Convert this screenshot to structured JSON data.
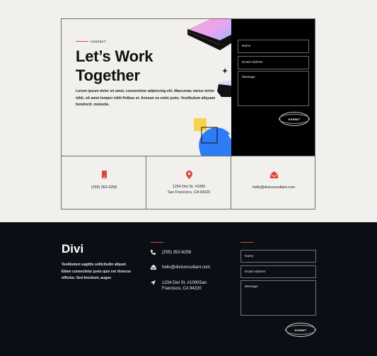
{
  "contact": {
    "eyebrow": "CONTACT",
    "title_line1": "Let’s Work",
    "title_line2": "Together",
    "lede": "Lorem ipsum dolor sit amet, consectetur adipiscing elit. Maecenas varius tortor nibh, sit amet tempor nibh finibus et. Aenean eu enim justo. Vestibulum aliquam hendrerit. molestie."
  },
  "form": {
    "name_placeholder": "Name",
    "email_placeholder": "Email Address",
    "message_placeholder": "Message",
    "submit_label": "SUBMIT"
  },
  "info": {
    "phone": "(255) 352-6258",
    "address_line1": "1234 Divi St. #1000",
    "address_line2": "San Francisco, CA 94220",
    "email": "hello@diviconsultant.com"
  },
  "footer": {
    "brand": "Divi",
    "about": "Vestibulum sagittis sollicitudin aliquet. Etiam consectetur justo quis est rhoncus efficitur. Sed tincidunt, augue",
    "phone": "(255) 352-6258",
    "email": "hello@diviconsultant.com",
    "address_line1": "1234 Divi St. #1000San",
    "address_line2": "Francisco, CA 94220",
    "form": {
      "name_placeholder": "Name",
      "email_placeholder": "Email Address",
      "message_placeholder": "Message",
      "submit_label": "SUBMIT"
    }
  },
  "colors": {
    "accent": "#e0473b",
    "footer_bg": "#0b0e14",
    "blue_shape": "#2f7df6",
    "yellow_shape": "#f7d34a"
  }
}
